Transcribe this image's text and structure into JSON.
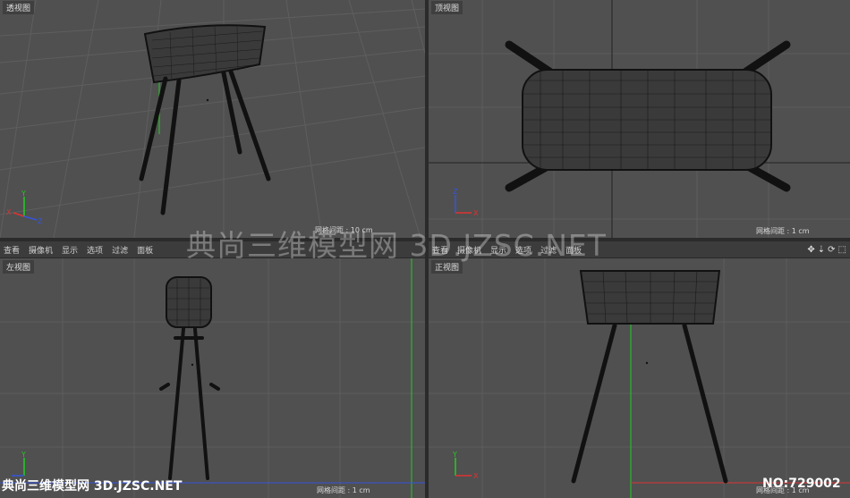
{
  "viewports": {
    "perspective": {
      "title": "透视图",
      "grid_label": "网格间距 : 10 cm"
    },
    "top": {
      "title": "顶视图",
      "grid_label": "网格间距 : 1 cm"
    },
    "left": {
      "title": "左视图",
      "grid_label": "网格间距 : 1 cm",
      "menu": [
        "查看",
        "摄像机",
        "显示",
        "选项",
        "过滤",
        "面板"
      ]
    },
    "front": {
      "title": "正视图",
      "grid_label": "网格间距 : 1 cm",
      "menu": [
        "查看",
        "摄像机",
        "显示",
        "选项",
        "过滤",
        "面板"
      ]
    }
  },
  "axes": {
    "x": "X",
    "y": "Y",
    "z": "Z"
  },
  "tool_icons": [
    "move-icon",
    "down-arrow-icon",
    "rotate-icon",
    "maximize-icon"
  ],
  "tool_glyphs": [
    "✥",
    "⇣",
    "⟳",
    "⬚"
  ],
  "watermark": "典尚三维模型网 3D.JZSC.NET",
  "watermark_bottom": "典尚三维模型网 3D.JZSC.NET",
  "model_number": "NO:729002",
  "colors": {
    "viewport_bg": "#505050",
    "grid": "#5d5d5d",
    "wire": "#111111",
    "axis_y": "#22cc22",
    "axis_x": "#dd3333",
    "axis_z": "#3355dd"
  }
}
